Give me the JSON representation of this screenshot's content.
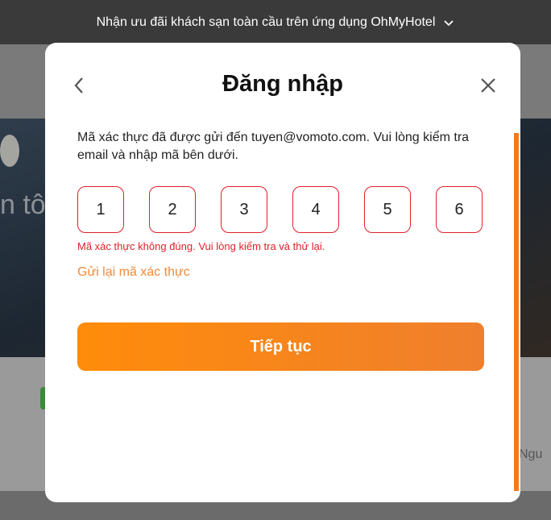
{
  "banner": {
    "text": "Nhận ưu đãi khách sạn toàn cầu trên ứng dụng OhMyHotel",
    "icon": "chevron-down-icon"
  },
  "background": {
    "partial_text": "n tô",
    "partial_right_text": "Ngu"
  },
  "modal": {
    "title": "Đăng nhập",
    "back_icon": "chevron-left-icon",
    "close_icon": "close-icon",
    "instructions": "Mã xác thực đã được gửi đến tuyen@vomoto.com. Vui lòng kiểm tra email và nhập mã bên dưới.",
    "otp": [
      "1",
      "2",
      "3",
      "4",
      "5",
      "6"
    ],
    "error": "Mã xác thực không đúng. Vui lòng kiểm tra và thử lại.",
    "resend": "Gửi lại mã xác thực",
    "continue": "Tiếp tục"
  },
  "colors": {
    "accent": "#ff8c0a",
    "error": "#e0202a",
    "link": "#ef8a3a"
  }
}
